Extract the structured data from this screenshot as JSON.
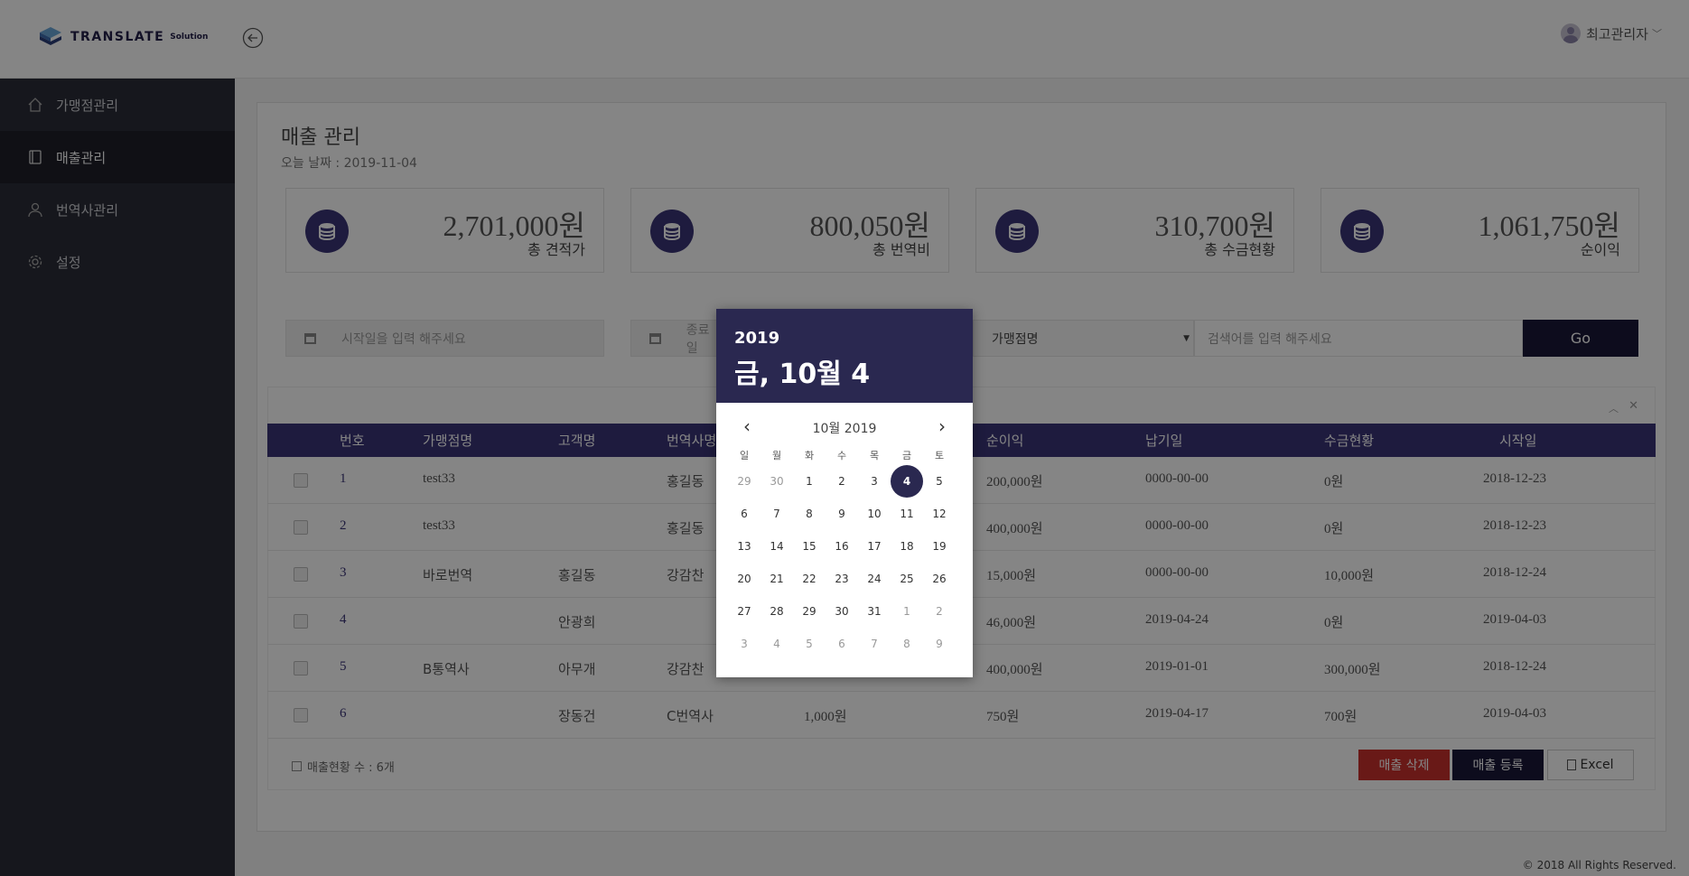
{
  "header": {
    "logo_text": "TRANSLATE",
    "logo_sub": "Solution",
    "user_name": "최고관리자"
  },
  "sidebar": {
    "items": [
      {
        "label": "가맹점관리",
        "icon": "home-icon",
        "active": false
      },
      {
        "label": "매출관리",
        "icon": "book-icon",
        "active": true
      },
      {
        "label": "번역사관리",
        "icon": "user-icon",
        "active": false
      },
      {
        "label": "설정",
        "icon": "gear-icon",
        "active": false
      }
    ]
  },
  "page": {
    "title": "매출 관리",
    "today": "오늘 날짜 : 2019-11-04"
  },
  "cards": [
    {
      "value": "2,701,000원",
      "label": "총 견적가",
      "icon": "coins-icon"
    },
    {
      "value": "800,050원",
      "label": "총 번역비",
      "icon": "coins-icon"
    },
    {
      "value": "310,700원",
      "label": "총 수금현황",
      "icon": "coins-icon"
    },
    {
      "value": "1,061,750원",
      "label": "순이익",
      "icon": "coins-icon"
    }
  ],
  "filters": {
    "start_placeholder": "시작일을 입력 해주세요",
    "end_placeholder": "종료일",
    "select_value": "가맹점명",
    "search_placeholder": "검색어를 입력 해주세요",
    "go_label": "Go"
  },
  "table": {
    "headers": [
      "번호",
      "가맹점명",
      "고객명",
      "번역사명",
      "순이익",
      "납기일",
      "수금현황",
      "시작일"
    ],
    "rows": [
      {
        "no": "1",
        "shop": "test33",
        "customer": "",
        "translator": "홍길동",
        "quote": "",
        "profit": "200,000원",
        "due": "0000-00-00",
        "collected": "0원",
        "start": "2018-12-23"
      },
      {
        "no": "2",
        "shop": "test33",
        "customer": "",
        "translator": "홍길동",
        "quote": "",
        "profit": "400,000원",
        "due": "0000-00-00",
        "collected": "0원",
        "start": "2018-12-23"
      },
      {
        "no": "3",
        "shop": "바로번역",
        "customer": "홍길동",
        "translator": "강감찬",
        "quote": "",
        "profit": "15,000원",
        "due": "0000-00-00",
        "collected": "10,000원",
        "start": "2018-12-24"
      },
      {
        "no": "4",
        "shop": "",
        "customer": "안광희",
        "translator": "",
        "quote": "",
        "profit": "46,000원",
        "due": "2019-04-24",
        "collected": "0원",
        "start": "2019-04-03"
      },
      {
        "no": "5",
        "shop": "B통역사",
        "customer": "아무개",
        "translator": "강감찬",
        "quote": "",
        "profit": "400,000원",
        "due": "2019-01-01",
        "collected": "300,000원",
        "start": "2018-12-24"
      },
      {
        "no": "6",
        "shop": "",
        "customer": "장동건",
        "translator": "C번역사",
        "quote": "1,000원",
        "profit": "750원",
        "due": "2019-04-17",
        "collected": "700원",
        "start": "2019-04-03"
      }
    ],
    "count_label": "매출현황 수 : 6개",
    "delete_label": "매출 삭제",
    "register_label": "매출 등록",
    "excel_label": "Excel"
  },
  "datepicker": {
    "year": "2019",
    "date_label": "금, 10월 4",
    "month_label": "10월 2019",
    "weekdays": [
      "일",
      "월",
      "화",
      "수",
      "목",
      "금",
      "토"
    ],
    "days": [
      [
        "29",
        "30",
        "1",
        "2",
        "3",
        "4",
        "5"
      ],
      [
        "6",
        "7",
        "8",
        "9",
        "10",
        "11",
        "12"
      ],
      [
        "13",
        "14",
        "15",
        "16",
        "17",
        "18",
        "19"
      ],
      [
        "20",
        "21",
        "22",
        "23",
        "24",
        "25",
        "26"
      ],
      [
        "27",
        "28",
        "29",
        "30",
        "31",
        "1",
        "2"
      ],
      [
        "3",
        "4",
        "5",
        "6",
        "7",
        "8",
        "9"
      ]
    ],
    "selected_day": "4",
    "prev_arrow": "‹",
    "next_arrow": "›"
  },
  "footer": "© 2018 All Rights Reserved."
}
